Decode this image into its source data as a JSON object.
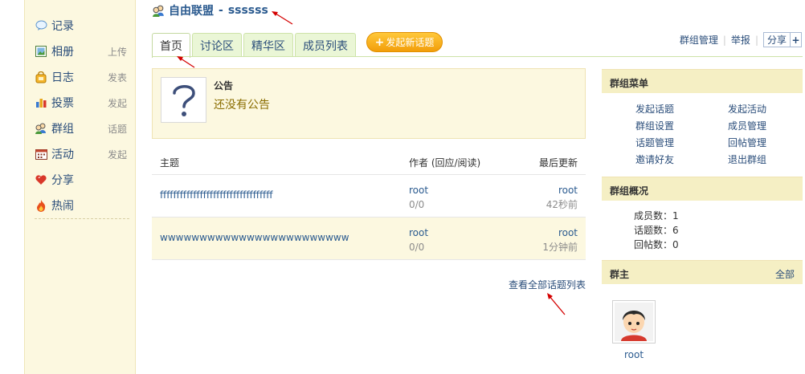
{
  "sidebar": {
    "items": [
      {
        "label": "记录",
        "sub": "",
        "icon": "bubble-icon"
      },
      {
        "label": "相册",
        "sub": "上传",
        "icon": "photo-icon"
      },
      {
        "label": "日志",
        "sub": "发表",
        "icon": "lock-icon"
      },
      {
        "label": "投票",
        "sub": "发起",
        "icon": "bar-chart-icon"
      },
      {
        "label": "群组",
        "sub": "话题",
        "icon": "group-icon"
      },
      {
        "label": "活动",
        "sub": "发起",
        "icon": "calendar-icon"
      },
      {
        "label": "分享",
        "sub": "",
        "icon": "heart-icon"
      },
      {
        "label": "热闹",
        "sub": "",
        "icon": "fire-icon"
      }
    ]
  },
  "header": {
    "group_name": "自由联盟",
    "separator": "-",
    "subtitle": "ssssss"
  },
  "tabs": [
    {
      "label": "首页",
      "active": true
    },
    {
      "label": "讨论区",
      "active": false
    },
    {
      "label": "精华区",
      "active": false
    },
    {
      "label": "成员列表",
      "active": false
    }
  ],
  "new_topic_label": "发起新话题",
  "toplinks": {
    "manage": "群组管理",
    "report": "举报",
    "share": "分享",
    "share_plus": "+"
  },
  "notice": {
    "title": "公告",
    "text": "还没有公告"
  },
  "topics": {
    "headers": {
      "subject": "主题",
      "author": "作者 (回应/阅读)",
      "last": "最后更新"
    },
    "rows": [
      {
        "subject": "ffffffffffffffffffffffffffffffffff",
        "author": "root",
        "counts": "0/0",
        "last_user": "root",
        "last_time": "42秒前"
      },
      {
        "subject": "wwwwwwwwwwwwwwwwwwwwwwww",
        "author": "root",
        "counts": "0/0",
        "last_user": "root",
        "last_time": "1分钟前"
      }
    ],
    "view_all": "查看全部话题列表"
  },
  "group_menu": {
    "title": "群组菜单",
    "items": [
      "发起话题",
      "发起活动",
      "群组设置",
      "成员管理",
      "话题管理",
      "回帖管理",
      "邀请好友",
      "退出群组"
    ]
  },
  "overview": {
    "title": "群组概况",
    "members": "成员数：1",
    "topics": "话题数：6",
    "replies": "回帖数：0"
  },
  "owner": {
    "title": "群主",
    "all": "全部",
    "name": "root"
  },
  "colors": {
    "sidebar_bg": "#fcf8e0",
    "link": "#2a4d7a",
    "button_orange": "#f29e0a",
    "annotation_red": "#d40000"
  }
}
